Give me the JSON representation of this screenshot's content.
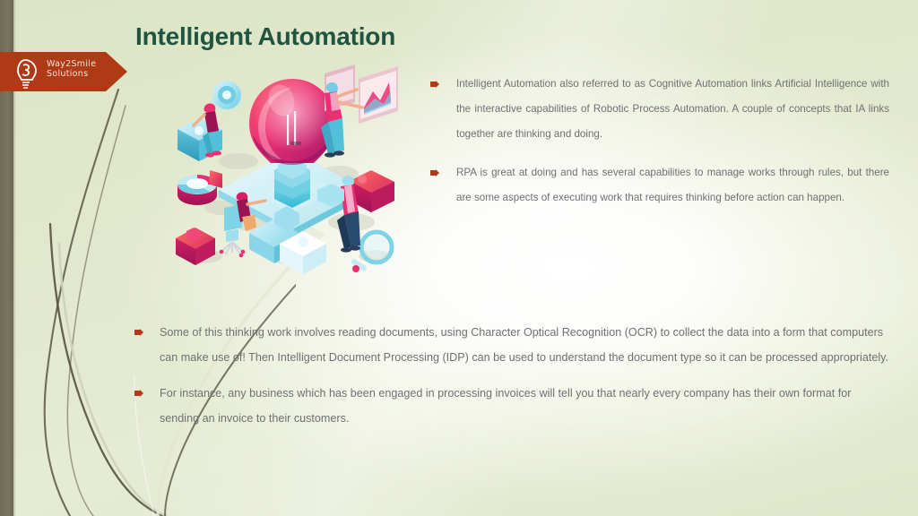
{
  "slide": {
    "title": "Intelligent Automation",
    "title_color": "#1f5540",
    "background_color": "#dfe6ca",
    "accent_color": "#b03a16",
    "band_color": "#6f6a55",
    "body_text_color": "#6f7073"
  },
  "logo": {
    "name_line1": "Way2Smile",
    "name_line2": "Solutions",
    "icon": "lightbulb-smile-logo-icon",
    "banner_color": "#b03a16"
  },
  "bullets_right": [
    {
      "marker": "arrow-bullet-icon",
      "text": "Intelligent Automation also referred to as Cognitive Automation links Artificial Intelligence with the interactive capabilities of Robotic Process Automation. A couple of concepts that IA links together are thinking and doing."
    },
    {
      "marker": "arrow-bullet-icon",
      "text": "RPA is great at doing and has several capabilities to manage works through rules, but there are some aspects of executing work that requires thinking before action can happen."
    }
  ],
  "bullets_bottom": [
    {
      "marker": "arrow-bullet-icon",
      "text": "Some of this thinking work involves reading documents, using Character Optical Recognition (OCR) to collect the data into a form that computers can make use of! Then Intelligent Document Processing (IDP) can be used to understand the document type so it can be processed appropriately."
    },
    {
      "marker": "arrow-bullet-icon",
      "text": "For instance, any business which has been engaged in processing invoices will tell you that nearly every company has their own format for sending an invoice to their customers."
    }
  ],
  "illustration": {
    "name": "intelligent-automation-isometric-illustration",
    "elements": [
      "glowing-lightbulb",
      "isometric-platform",
      "puzzle-pieces",
      "pie-chart",
      "dashboard-screens",
      "magnifying-glass",
      "person-standing-left",
      "person-seated-at-desk",
      "person-at-dashboard",
      "person-with-puzzle-piece"
    ]
  }
}
